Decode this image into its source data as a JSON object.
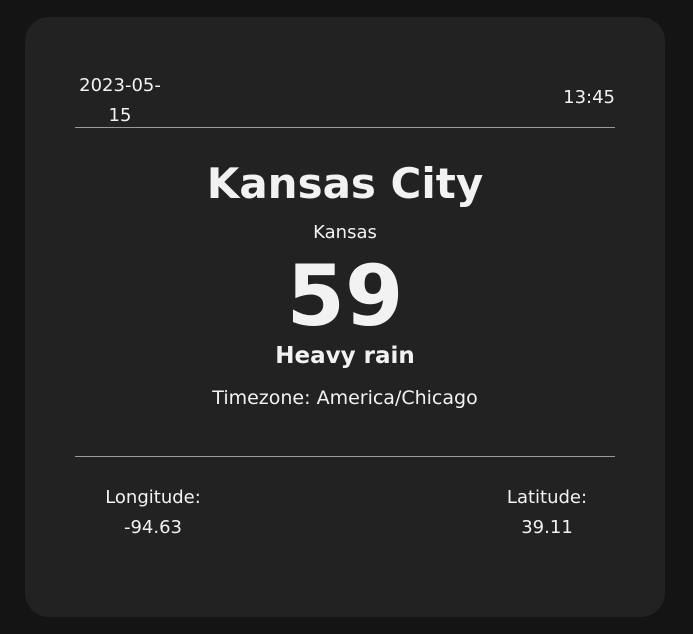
{
  "header": {
    "date": "2023-05-15",
    "date_line1": "2023-05-",
    "date_line2": "15",
    "time": "13:45"
  },
  "location": {
    "city": "Kansas City",
    "state": "Kansas"
  },
  "weather": {
    "temperature": "59",
    "condition": "Heavy rain",
    "timezone": "Timezone: America/Chicago"
  },
  "coordinates": {
    "longitude_label": "Longitude:",
    "longitude_value": "-94.63",
    "latitude_label": "Latitude:",
    "latitude_value": "39.11"
  }
}
